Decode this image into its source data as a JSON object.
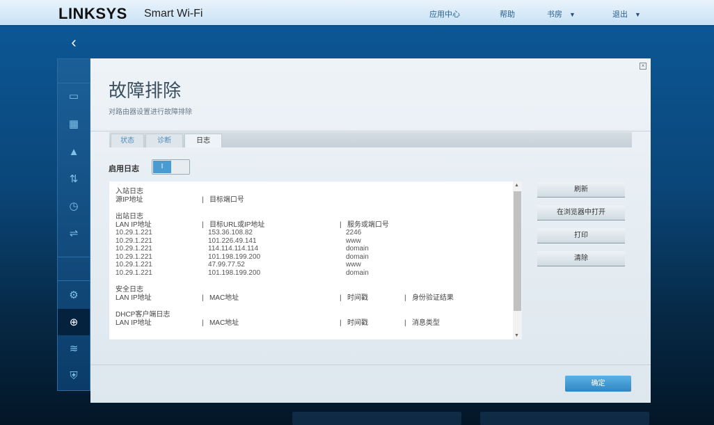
{
  "header": {
    "brand": "LINKSYS",
    "brand_sub": "Smart Wi-Fi",
    "nav": [
      {
        "label": "应用中心"
      },
      {
        "label": "帮助"
      },
      {
        "label": "书房",
        "dropdown": true
      },
      {
        "label": "退出",
        "dropdown": true
      }
    ]
  },
  "sidebar": {
    "back_icon": "chevron-left-icon",
    "items": [
      {
        "icon": "devices-icon"
      },
      {
        "icon": "parental-controls-icon"
      },
      {
        "icon": "alert-icon"
      },
      {
        "icon": "priority-icon"
      },
      {
        "icon": "speed-test-icon"
      },
      {
        "icon": "usb-storage-icon"
      },
      {
        "icon": "settings-gear-icon"
      },
      {
        "icon": "troubleshooting-icon",
        "selected": true
      },
      {
        "icon": "wifi-settings-icon"
      },
      {
        "icon": "security-shield-icon"
      }
    ]
  },
  "dialog": {
    "title": "故障排除",
    "subtitle": "对路由器设置进行故障排除",
    "tabs": [
      {
        "label": "状态"
      },
      {
        "label": "诊断"
      },
      {
        "label": "日志",
        "active": true
      }
    ],
    "enable_log_label": "启用日志",
    "toggle_on_text": "I",
    "toggle_state": "on",
    "log": {
      "incoming": {
        "title": "入站日志",
        "headers": [
          "源IP地址",
          "目标端口号"
        ]
      },
      "outgoing": {
        "title": "出站日志",
        "headers": [
          "LAN IP地址",
          "目标URL或IP地址",
          "服务或端口号"
        ],
        "rows": [
          [
            "10.29.1.221",
            "153.36.108.82",
            "2246"
          ],
          [
            "10.29.1.221",
            "101.226.49.141",
            "www"
          ],
          [
            "10.29.1.221",
            "114.114.114.114",
            "domain"
          ],
          [
            "10.29.1.221",
            "101.198.199.200",
            "domain"
          ],
          [
            "10.29.1.221",
            "47.99.77.52",
            "www"
          ],
          [
            "10.29.1.221",
            "101.198.199.200",
            "domain"
          ]
        ]
      },
      "security": {
        "title": "安全日志",
        "headers": [
          "LAN IP地址",
          "MAC地址",
          "时间戳",
          "身份验证结果"
        ]
      },
      "dhcp": {
        "title": "DHCP客户端日志",
        "headers": [
          "LAN IP地址",
          "MAC地址",
          "时间戳",
          "消息类型"
        ]
      }
    },
    "buttons": {
      "refresh": "刷新",
      "open_in_browser": "在浏览器中打开",
      "print": "打印",
      "clear": "清除"
    },
    "ok": "确定"
  }
}
